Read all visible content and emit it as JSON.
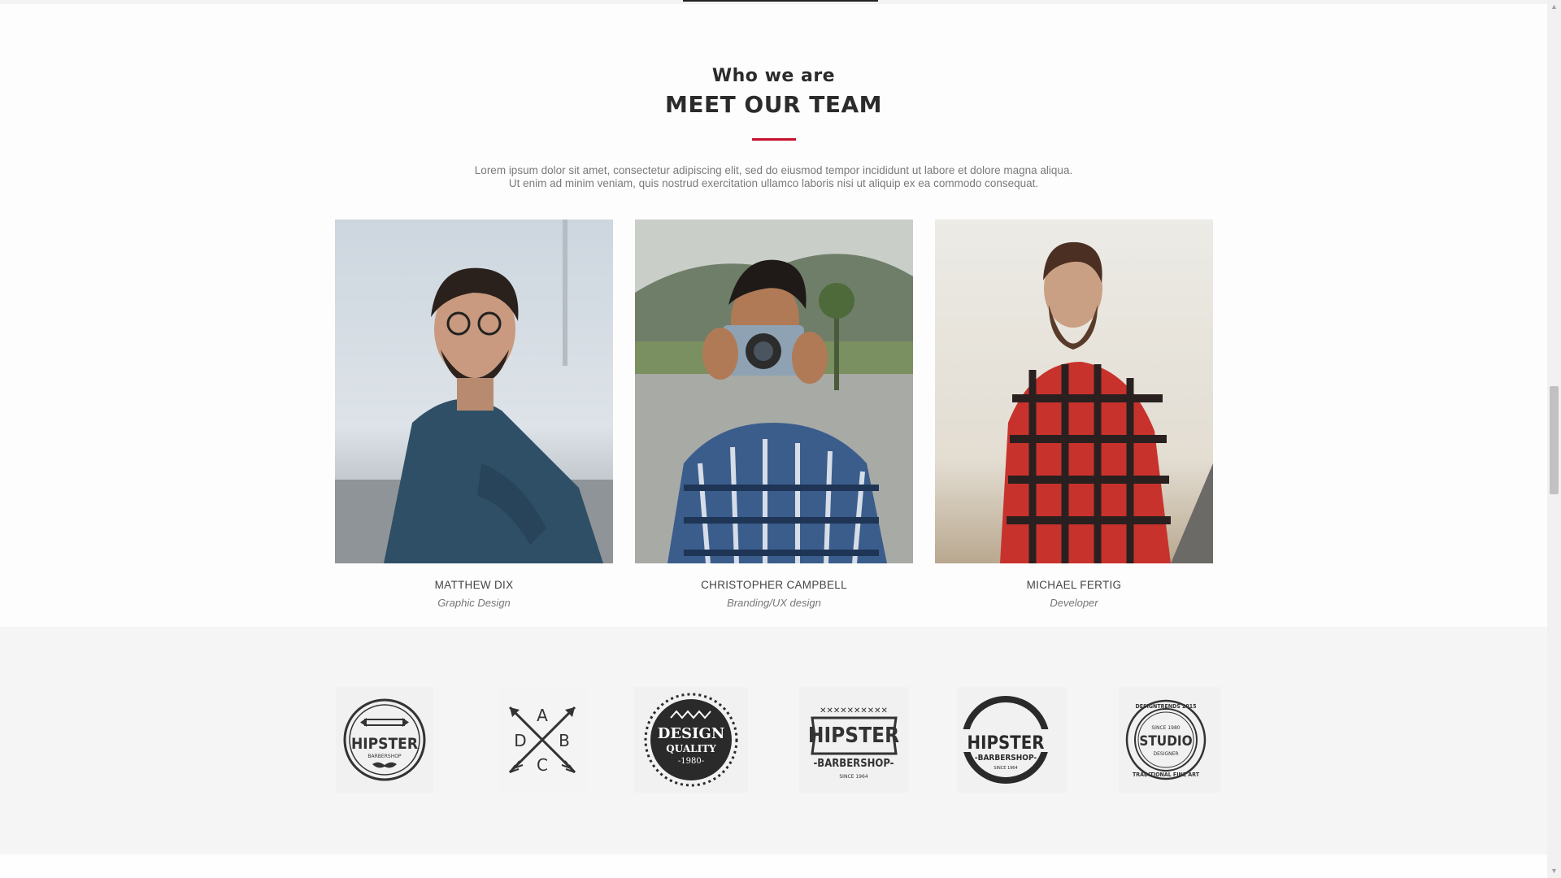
{
  "team": {
    "kicker": "Who we are",
    "title": "MEET OUR TEAM",
    "intro_line1": "Lorem ipsum dolor sit amet, consectetur adipiscing elit, sed do eiusmod tempor incididunt ut labore et dolore magna aliqua.",
    "intro_line2": "Ut enim ad minim veniam, quis nostrud exercitation ullamco laboris nisi ut aliquip ex ea commodo consequat.",
    "accent_color": "#c8102e",
    "members": [
      {
        "name": "MATTHEW DIX",
        "role": "Graphic Design"
      },
      {
        "name": "CHRISTOPHER CAMPBELL",
        "role": "Branding/UX design"
      },
      {
        "name": "MICHAEL FERTIG",
        "role": "Developer"
      }
    ]
  },
  "logos": [
    {
      "icon": "hipster-barbershop-round-badge-icon",
      "text_main": "HIPSTER",
      "text_sub": "BARBERSHOP"
    },
    {
      "icon": "abcd-crossed-arrows-icon",
      "letters": [
        "A",
        "D",
        "B",
        "C"
      ]
    },
    {
      "icon": "design-quality-badge-icon",
      "text_main": "DESIGN",
      "text_sub": "QUALITY",
      "text_year": "-1980-"
    },
    {
      "icon": "hipster-barbershop-banner-icon",
      "text_main": "HIPSTER",
      "text_sub": "-BARBERSHOP-",
      "text_year": "SINCE 1964"
    },
    {
      "icon": "hipster-barbershop-ring-badge-icon",
      "text_main": "HIPSTER",
      "text_sub": "-BARBERSHOP-",
      "text_year": "SINCE 1964"
    },
    {
      "icon": "studio-designtrends-badge-icon",
      "text_top": "DESIGNTRENDS 2015",
      "text_since": "SINCE 1980",
      "text_main": "STUDIO",
      "text_sub": "DESIGNER",
      "text_bottom": "TRADITIONAL FINE ART"
    }
  ],
  "scrollbar": {
    "up_icon": "scroll-up-arrow-icon",
    "down_icon": "scroll-down-arrow-icon",
    "position_fraction": 0.45
  }
}
